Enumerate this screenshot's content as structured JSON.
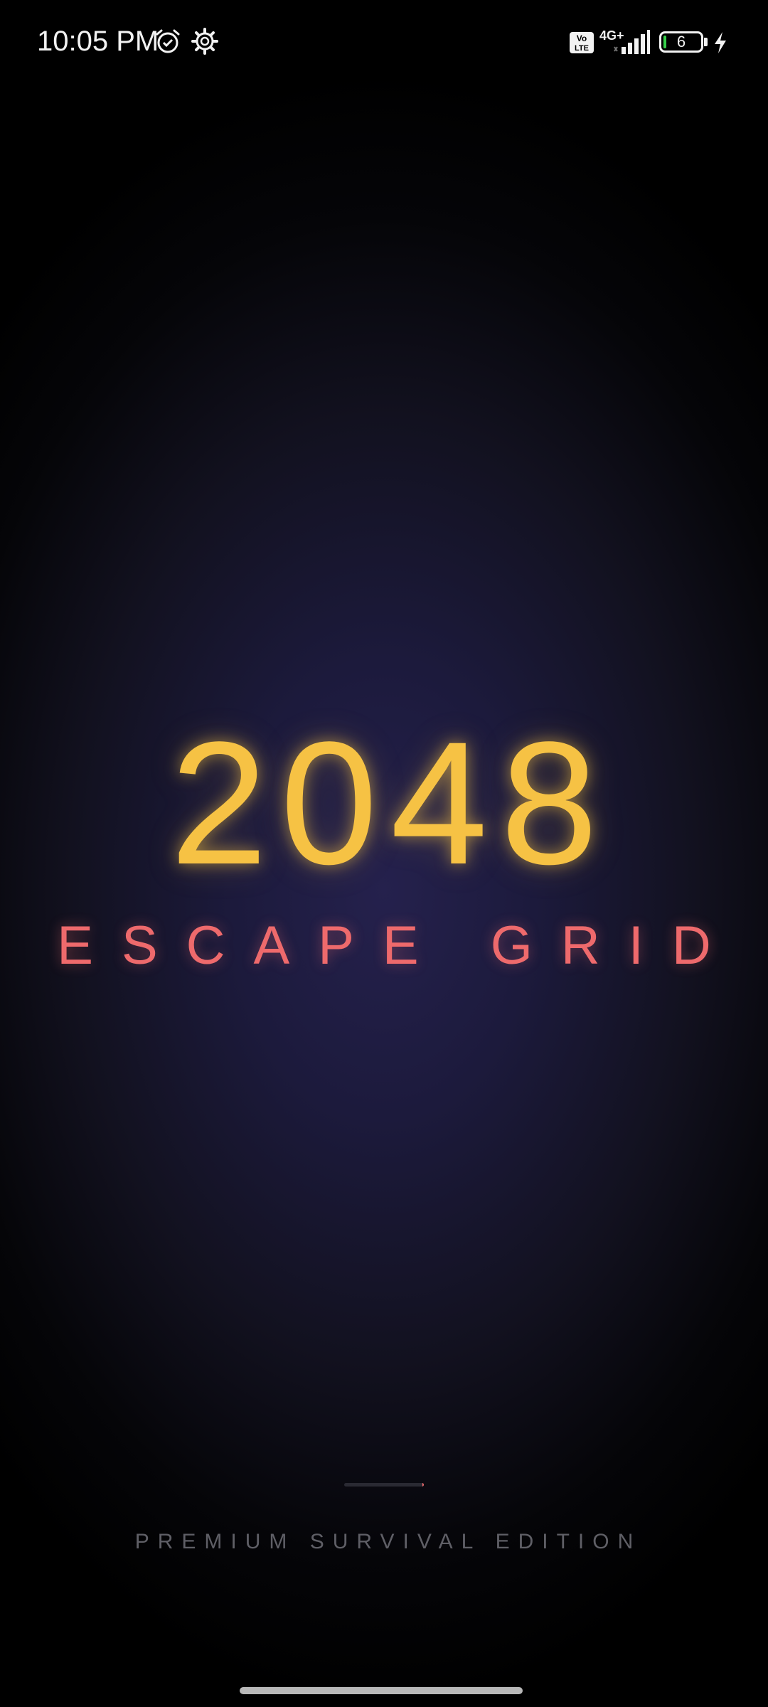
{
  "status_bar": {
    "time": "10:05 PM",
    "network_type": "4G+",
    "volte_label": "Vo LTE",
    "battery_level": "6",
    "battery_fraction": 0.06,
    "icons": [
      "alarm-icon",
      "gear-icon",
      "volte-icon",
      "signal-icon",
      "battery-icon",
      "charging-icon"
    ]
  },
  "splash": {
    "title": "2048",
    "subtitle": "ESCAPE GRID",
    "loading_progress": 0.02,
    "edition": "PREMIUM SURVIVAL EDITION"
  },
  "colors": {
    "title": "#f6c244",
    "subtitle": "#ee6a6c",
    "edition": "#5f5f66",
    "background_center": "#25214d",
    "background_edge": "#000000"
  }
}
